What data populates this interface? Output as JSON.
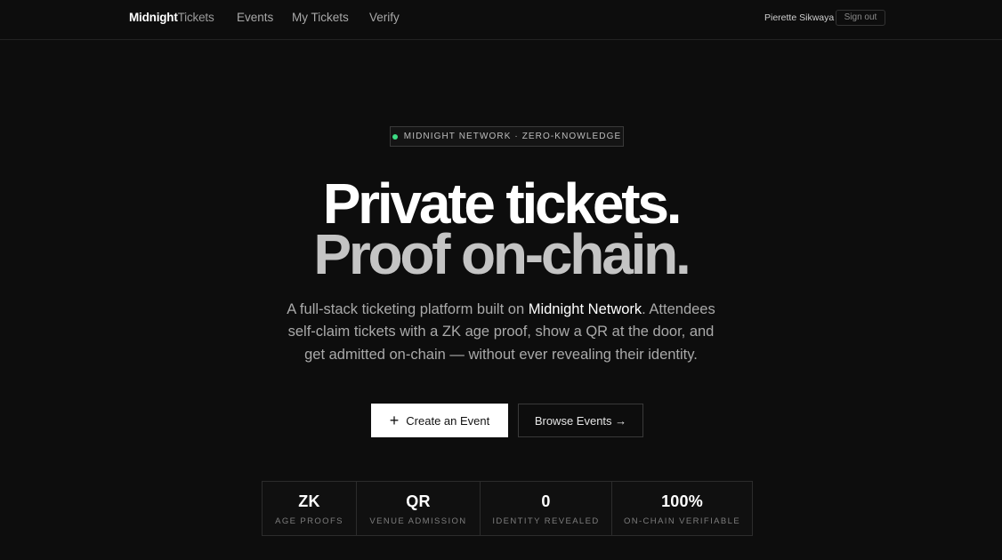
{
  "nav": {
    "brand_bold": "Midnight",
    "brand_light": "Tickets",
    "links": [
      {
        "label": "Events"
      },
      {
        "label": "My Tickets"
      },
      {
        "label": "Verify"
      }
    ],
    "user_name": "Pierette Sikwaya",
    "signout_label": "Sign out"
  },
  "hero": {
    "badge_text": "MIDNIGHT NETWORK · ZERO-KNOWLEDGE",
    "badge_dot_color": "#3ddc84",
    "headline_line1": "Private tickets.",
    "headline_line2": "Proof on-chain.",
    "sub_line1_pre": "A full-stack ticketing platform built on ",
    "sub_line1_highlight": "Midnight Network",
    "sub_line1_post": ". Attendees",
    "sub_line2": "self-claim tickets with a ZK age proof, show a QR at the door, and",
    "sub_line3": "get admitted on-chain — without ever revealing their identity.",
    "primary_button": {
      "icon": "plus-icon",
      "label": "Create an Event"
    },
    "secondary_button": {
      "label": "Browse Events →"
    }
  },
  "stats": [
    {
      "value": "ZK",
      "label": "AGE PROOFS"
    },
    {
      "value": "QR",
      "label": "VENUE ADMISSION"
    },
    {
      "value": "0",
      "label": "IDENTITY REVEALED"
    },
    {
      "value": "100%",
      "label": "ON-CHAIN VERIFIABLE"
    }
  ],
  "colors": {
    "background": "#0d0d0d",
    "primary_button_bg": "#ffffff",
    "accent_green": "#3ddc84"
  }
}
